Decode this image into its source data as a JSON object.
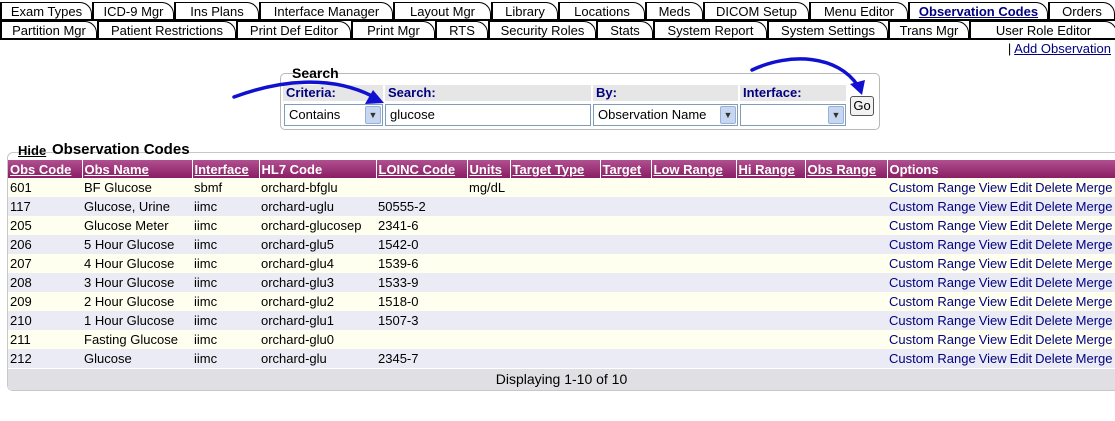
{
  "tabs_row1": [
    {
      "label": "Exam Types",
      "w": 92,
      "active": false
    },
    {
      "label": "ICD-9 Mgr",
      "w": 82,
      "active": false
    },
    {
      "label": "Ins Plans",
      "w": 85,
      "active": false
    },
    {
      "label": "Interface Manager",
      "w": 134,
      "active": false
    },
    {
      "label": "Layout Mgr",
      "w": 98,
      "active": false
    },
    {
      "label": "Library",
      "w": 67,
      "active": false
    },
    {
      "label": "Locations",
      "w": 87,
      "active": false
    },
    {
      "label": "Meds",
      "w": 58,
      "active": false
    },
    {
      "label": "DICOM Setup",
      "w": 106,
      "active": false
    },
    {
      "label": "Menu Editor",
      "w": 99,
      "active": false
    },
    {
      "label": "Observation Codes",
      "w": 140,
      "active": true
    },
    {
      "label": "Orders",
      "w": 67,
      "active": false
    }
  ],
  "tabs_row2": [
    {
      "label": "Partition Mgr",
      "w": 97,
      "active": false
    },
    {
      "label": "Patient Restrictions",
      "w": 139,
      "active": false
    },
    {
      "label": "Print Def Editor",
      "w": 115,
      "active": false
    },
    {
      "label": "Print Mgr",
      "w": 84,
      "active": false
    },
    {
      "label": "RTS",
      "w": 53,
      "active": false
    },
    {
      "label": "Security Roles",
      "w": 108,
      "active": false
    },
    {
      "label": "Stats",
      "w": 57,
      "active": false
    },
    {
      "label": "System Report",
      "w": 114,
      "active": false
    },
    {
      "label": "System Settings",
      "w": 121,
      "active": false
    },
    {
      "label": "Trans Mgr",
      "w": 81,
      "active": false
    },
    {
      "label": "User Role Editor",
      "w": 148,
      "active": false
    }
  ],
  "add_link": {
    "separator": "|",
    "label": "Add Observation"
  },
  "search": {
    "title": "Search",
    "criteria_label": "Criteria:",
    "criteria_value": "Contains",
    "search_label": "Search:",
    "search_value": "glucose",
    "by_label": "By:",
    "by_value": "Observation Name",
    "interface_label": "Interface:",
    "interface_value": "",
    "go_label": "Go"
  },
  "section": {
    "hide_label": "Hide",
    "title": "Observation Codes"
  },
  "columns": [
    {
      "label": "Obs Code",
      "sortable": true
    },
    {
      "label": "Obs Name",
      "sortable": true
    },
    {
      "label": "Interface",
      "sortable": true
    },
    {
      "label": "HL7 Code",
      "sortable": false
    },
    {
      "label": "LOINC Code",
      "sortable": true
    },
    {
      "label": "Units",
      "sortable": true
    },
    {
      "label": "Target Type",
      "sortable": true
    },
    {
      "label": "Target",
      "sortable": true
    },
    {
      "label": "Low Range",
      "sortable": true
    },
    {
      "label": "Hi Range",
      "sortable": true
    },
    {
      "label": "Obs Range",
      "sortable": true
    },
    {
      "label": "Options",
      "sortable": false
    }
  ],
  "rows": [
    [
      "601",
      "BF Glucose",
      "sbmf",
      "orchard-bfglu",
      "",
      "mg/dL",
      "",
      "",
      "",
      "",
      ""
    ],
    [
      "117",
      "Glucose, Urine",
      "iimc",
      "orchard-uglu",
      "50555-2",
      "",
      "",
      "",
      "",
      "",
      ""
    ],
    [
      "205",
      "Glucose Meter",
      "iimc",
      "orchard-glucosep",
      "2341-6",
      "",
      "",
      "",
      "",
      "",
      ""
    ],
    [
      "206",
      "5 Hour Glucose",
      "iimc",
      "orchard-glu5",
      "1542-0",
      "",
      "",
      "",
      "",
      "",
      ""
    ],
    [
      "207",
      "4 Hour Glucose",
      "iimc",
      "orchard-glu4",
      "1539-6",
      "",
      "",
      "",
      "",
      "",
      ""
    ],
    [
      "208",
      "3 Hour Glucose",
      "iimc",
      "orchard-glu3",
      "1533-9",
      "",
      "",
      "",
      "",
      "",
      ""
    ],
    [
      "209",
      "2 Hour Glucose",
      "iimc",
      "orchard-glu2",
      "1518-0",
      "",
      "",
      "",
      "",
      "",
      ""
    ],
    [
      "210",
      "1 Hour Glucose",
      "iimc",
      "orchard-glu1",
      "1507-3",
      "",
      "",
      "",
      "",
      "",
      ""
    ],
    [
      "211",
      "Fasting Glucose",
      "iimc",
      "orchard-glu0",
      "",
      "",
      "",
      "",
      "",
      "",
      ""
    ],
    [
      "212",
      "Glucose",
      "iimc",
      "orchard-glu",
      "2345-7",
      "",
      "",
      "",
      "",
      "",
      ""
    ]
  ],
  "row_options": [
    "Custom Range",
    "View",
    "Edit",
    "Delete",
    "Merge"
  ],
  "footer": "Displaying 1-10 of 10",
  "colors": {
    "header_bg": "#8b1d64",
    "link": "#000080",
    "row_odd": "#fffff0",
    "row_even": "#ebebf5",
    "arrow": "#1010d0"
  }
}
